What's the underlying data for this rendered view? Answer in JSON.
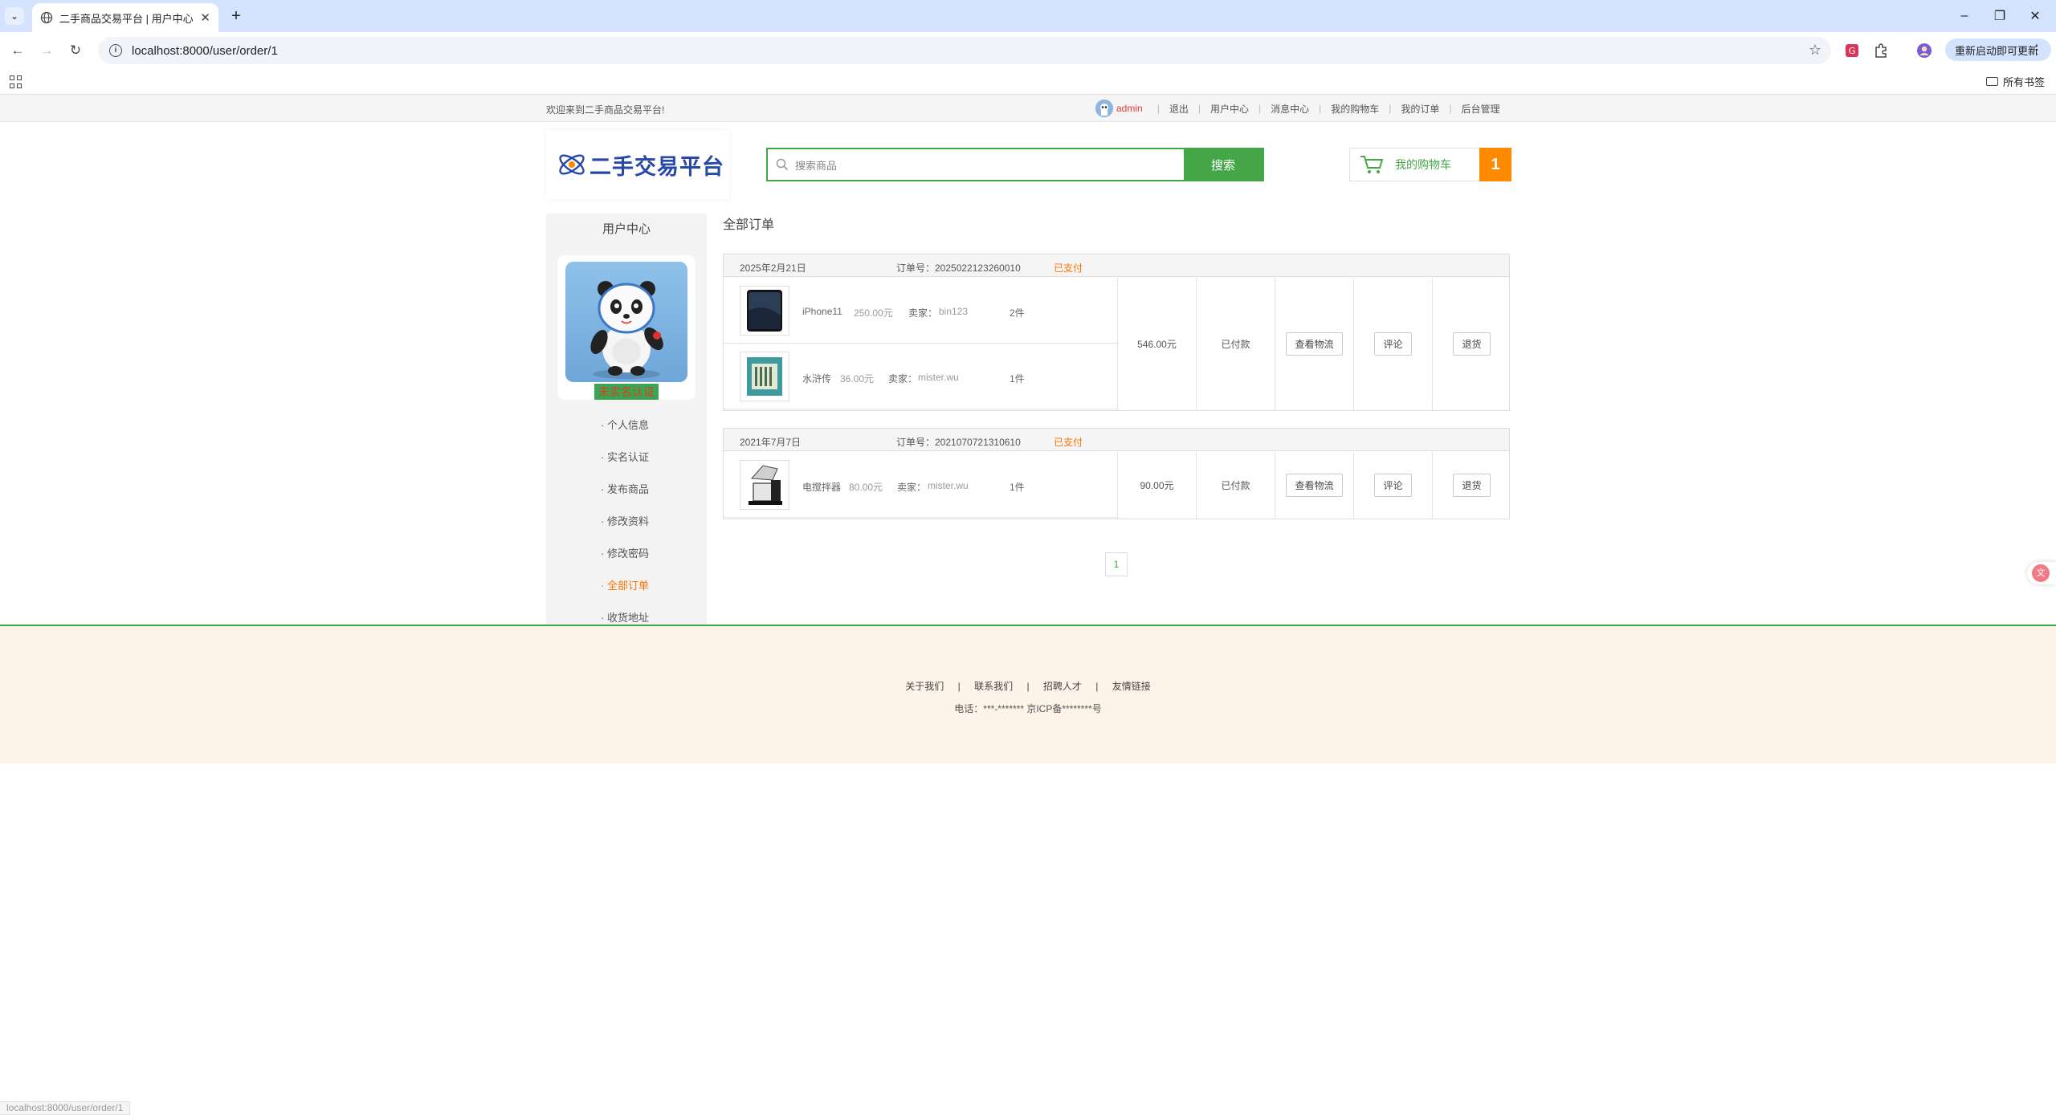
{
  "browser": {
    "tab_title": "二手商品交易平台 | 用户中心",
    "url": "localhost:8000/user/order/1",
    "update_label": "重新启动即可更新",
    "all_bookmarks": "所有书签"
  },
  "topbar": {
    "welcome": "欢迎来到二手商品交易平台!",
    "username": "admin",
    "links": [
      "退出",
      "用户中心",
      "消息中心",
      "我的购物车",
      "我的订单",
      "后台管理"
    ]
  },
  "header": {
    "logo_text": "二手交易平台",
    "search_placeholder": "搜索商品",
    "search_button": "搜索",
    "cart_label": "我的购物车",
    "cart_count": "1"
  },
  "sidebar": {
    "title": "用户中心",
    "verify_label": "未实名认证",
    "menu": [
      "· 个人信息",
      "· 实名认证",
      "· 发布商品",
      "· 修改资料",
      "· 修改密码",
      "· 全部订单",
      "· 收货地址"
    ]
  },
  "main": {
    "title": "全部订单",
    "orders": [
      {
        "date": "2025年2月21日",
        "order_no": "订单号：2025022123260010",
        "status": "已支付",
        "items": [
          {
            "name": "iPhone11",
            "price": "250.00元",
            "seller_label": "卖家：",
            "seller": "bin123",
            "qty": "2件"
          },
          {
            "name": "水浒传",
            "price": "36.00元",
            "seller_label": "卖家：",
            "seller": "mister.wu",
            "qty": "1件"
          }
        ],
        "total": "546.00元",
        "pay_state": "已付款",
        "logistics": "查看物流",
        "comment": "评论",
        "refund": "退货"
      },
      {
        "date": "2021年7月7日",
        "order_no": "订单号：2021070721310610",
        "status": "已支付",
        "items": [
          {
            "name": "电搅拌器",
            "price": "80.00元",
            "seller_label": "卖家：",
            "seller": "mister.wu",
            "qty": "1件"
          }
        ],
        "total": "90.00元",
        "pay_state": "已付款",
        "logistics": "查看物流",
        "comment": "评论",
        "refund": "退货"
      }
    ],
    "page": "1"
  },
  "footer": {
    "links": [
      "关于我们",
      "联系我们",
      "招聘人才",
      "友情链接"
    ],
    "sep": "|",
    "info": "电话：***-******* 京ICP备********号"
  },
  "status_bar": "localhost:8000/user/order/1",
  "colors": {
    "accent_green": "#45a647",
    "accent_orange": "#ff7200",
    "logo_blue": "#2748a8"
  }
}
